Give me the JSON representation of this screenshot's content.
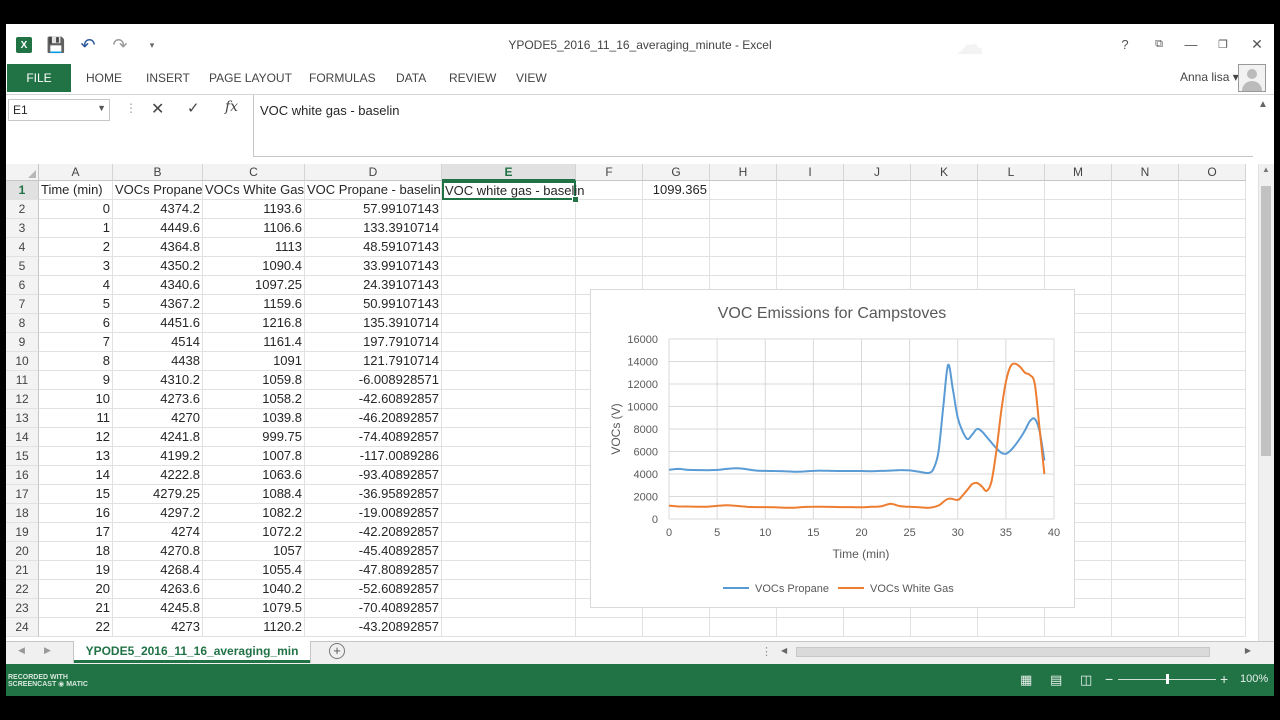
{
  "window": {
    "title": "YPODE5_2016_11_16_averaging_minute - Excel",
    "help": "?",
    "minimize": "—",
    "restore": "❐",
    "close": "✕",
    "ribbon_display": "⧉"
  },
  "quick_access": {
    "excel_icon": "X",
    "save_icon": "💾",
    "undo_icon": "↶",
    "redo_icon": "↷",
    "customize_icon": "▾"
  },
  "ribbon": {
    "file": "FILE",
    "tabs": [
      "HOME",
      "INSERT",
      "PAGE LAYOUT",
      "FORMULAS",
      "DATA",
      "REVIEW",
      "VIEW"
    ],
    "user": "Anna lisa ▾"
  },
  "formula_bar": {
    "name_box": "E1",
    "name_box_arrow": "▼",
    "dots": "⋮",
    "cancel": "✕",
    "enter": "✓",
    "fx": "fx",
    "content": "VOC white gas - baselin",
    "expand": "▲"
  },
  "columns": [
    "A",
    "B",
    "C",
    "D",
    "E",
    "F",
    "G",
    "H",
    "I",
    "J",
    "K",
    "L",
    "M",
    "N",
    "O"
  ],
  "selected_column": "E",
  "header_row": {
    "A": "Time (min)",
    "B": "VOCs Propane",
    "C": "VOCs White Gas",
    "D": "VOC Propane - baseline",
    "E": "VOC white gas - baselin",
    "G": "1099.365"
  },
  "rows": [
    [
      "2",
      "0",
      "4374.2",
      "1193.6",
      "57.99107143"
    ],
    [
      "3",
      "1",
      "4449.6",
      "1106.6",
      "133.3910714"
    ],
    [
      "4",
      "2",
      "4364.8",
      "1113",
      "48.59107143"
    ],
    [
      "5",
      "3",
      "4350.2",
      "1090.4",
      "33.99107143"
    ],
    [
      "6",
      "4",
      "4340.6",
      "1097.25",
      "24.39107143"
    ],
    [
      "7",
      "5",
      "4367.2",
      "1159.6",
      "50.99107143"
    ],
    [
      "8",
      "6",
      "4451.6",
      "1216.8",
      "135.3910714"
    ],
    [
      "9",
      "7",
      "4514",
      "1161.4",
      "197.7910714"
    ],
    [
      "10",
      "8",
      "4438",
      "1091",
      "121.7910714"
    ],
    [
      "11",
      "9",
      "4310.2",
      "1059.8",
      "-6.008928571"
    ],
    [
      "12",
      "10",
      "4273.6",
      "1058.2",
      "-42.60892857"
    ],
    [
      "13",
      "11",
      "4270",
      "1039.8",
      "-46.20892857"
    ],
    [
      "14",
      "12",
      "4241.8",
      "999.75",
      "-74.40892857"
    ],
    [
      "15",
      "13",
      "4199.2",
      "1007.8",
      "-117.0089286"
    ],
    [
      "16",
      "14",
      "4222.8",
      "1063.6",
      "-93.40892857"
    ],
    [
      "17",
      "15",
      "4279.25",
      "1088.4",
      "-36.95892857"
    ],
    [
      "18",
      "16",
      "4297.2",
      "1082.2",
      "-19.00892857"
    ],
    [
      "19",
      "17",
      "4274",
      "1072.2",
      "-42.20892857"
    ],
    [
      "20",
      "18",
      "4270.8",
      "1057",
      "-45.40892857"
    ],
    [
      "21",
      "19",
      "4268.4",
      "1055.4",
      "-47.80892857"
    ],
    [
      "22",
      "20",
      "4263.6",
      "1040.2",
      "-52.60892857"
    ],
    [
      "23",
      "21",
      "4245.8",
      "1079.5",
      "-70.40892857"
    ],
    [
      "24",
      "22",
      "4273",
      "1120.2",
      "-43.20892857"
    ]
  ],
  "sheet_tab": {
    "name": "YPODE5_2016_11_16_averaging_min",
    "add": "+",
    "prev": "◀",
    "next": "▶"
  },
  "statusbar": {
    "watermark_top": "RECORDED WITH",
    "watermark_bottom": "SCREENCAST ◉ MATIC",
    "zoom_minus": "−",
    "zoom_plus": "+",
    "zoom": "100%",
    "zoom_fraction": 0.5
  },
  "colors": {
    "accent": "#217346",
    "series_propane": "#5b9bd5",
    "series_white_gas": "#ed7d31"
  },
  "chart_data": {
    "type": "line",
    "title": "VOC Emissions for Campstoves",
    "xlabel": "Time (min)",
    "ylabel": "VOCs (V)",
    "xlim": [
      0,
      40
    ],
    "ylim": [
      0,
      16000
    ],
    "xticks": [
      0,
      5,
      10,
      15,
      20,
      25,
      30,
      35,
      40
    ],
    "yticks": [
      0,
      2000,
      4000,
      6000,
      8000,
      10000,
      12000,
      14000,
      16000
    ],
    "grid": true,
    "legend": "bottom",
    "series": [
      {
        "name": "VOCs Propane",
        "color": "#5b9bd5",
        "x": [
          0,
          1,
          2,
          3,
          4,
          5,
          6,
          7,
          8,
          9,
          10,
          11,
          12,
          13,
          14,
          15,
          16,
          17,
          18,
          19,
          20,
          21,
          22,
          23,
          24,
          25,
          26,
          27,
          27.5,
          28,
          28.5,
          29,
          29.5,
          30,
          30.5,
          31,
          31.5,
          32,
          32.5,
          33,
          33.5,
          34,
          34.5,
          35,
          35.5,
          36,
          36.5,
          37,
          37.5,
          38,
          38.5,
          39
        ],
        "y": [
          4374,
          4450,
          4365,
          4350,
          4341,
          4367,
          4452,
          4514,
          4438,
          4310,
          4274,
          4270,
          4242,
          4199,
          4223,
          4279,
          4297,
          4274,
          4271,
          4268,
          4264,
          4246,
          4273,
          4300,
          4350,
          4320,
          4200,
          4100,
          4500,
          6000,
          10000,
          13700,
          11500,
          9000,
          7800,
          7100,
          7500,
          8000,
          7800,
          7300,
          6800,
          6300,
          5900,
          5800,
          6100,
          6600,
          7200,
          7900,
          8700,
          8900,
          7800,
          5200
        ]
      },
      {
        "name": "VOCs White Gas",
        "color": "#ed7d31",
        "x": [
          0,
          1,
          2,
          3,
          4,
          5,
          6,
          7,
          8,
          9,
          10,
          11,
          12,
          13,
          14,
          15,
          16,
          17,
          18,
          19,
          20,
          21,
          22,
          23,
          24,
          25,
          26,
          27,
          28,
          29,
          30,
          30.5,
          31,
          31.5,
          32,
          32.5,
          33,
          33.5,
          34,
          34.5,
          35,
          35.5,
          36,
          36.5,
          37,
          37.5,
          38,
          38.5,
          39
        ],
        "y": [
          1194,
          1107,
          1113,
          1090,
          1097,
          1160,
          1217,
          1161,
          1091,
          1060,
          1058,
          1040,
          1000,
          1008,
          1064,
          1088,
          1082,
          1072,
          1057,
          1055,
          1040,
          1080,
          1120,
          1350,
          1150,
          1080,
          1050,
          1000,
          1200,
          1800,
          1700,
          2100,
          2600,
          3100,
          3200,
          2900,
          2500,
          3300,
          6000,
          9500,
          12200,
          13600,
          13800,
          13500,
          13000,
          12800,
          12000,
          8000,
          4000
        ]
      }
    ]
  }
}
